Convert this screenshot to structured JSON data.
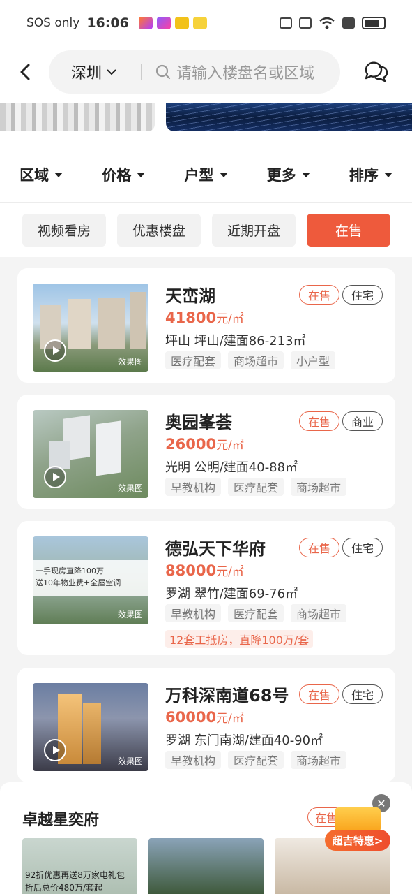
{
  "status_bar": {
    "carrier": "SOS only",
    "time": "16:06"
  },
  "header": {
    "city": "深圳",
    "search_placeholder": "请输入楼盘名或区域"
  },
  "filters": [
    "区域",
    "价格",
    "户型",
    "更多",
    "排序"
  ],
  "chips": [
    {
      "label": "视频看房",
      "active": false
    },
    {
      "label": "优惠楼盘",
      "active": false
    },
    {
      "label": "近期开盘",
      "active": false
    },
    {
      "label": "在售",
      "active": true
    }
  ],
  "listings": [
    {
      "name": "天峦湖",
      "status": "在售",
      "type": "住宅",
      "price": "41800",
      "price_unit": "元/㎡",
      "location": "坪山 坪山/建面86-213㎡",
      "tags": [
        "医疗配套",
        "商场超市",
        "小户型"
      ],
      "image_label": "效果图"
    },
    {
      "name": "奥园峯荟",
      "status": "在售",
      "type": "商业",
      "price": "26000",
      "price_unit": "元/㎡",
      "location": "光明 公明/建面40-88㎡",
      "tags": [
        "早教机构",
        "医疗配套",
        "商场超市"
      ],
      "image_label": "效果图"
    },
    {
      "name": "德弘天下华府",
      "status": "在售",
      "type": "住宅",
      "price": "88000",
      "price_unit": "元/㎡",
      "location": "罗湖 翠竹/建面69-76㎡",
      "tags": [
        "早教机构",
        "医疗配套",
        "商场超市"
      ],
      "promo": "12套工抵房，直降100万/套",
      "image_promo_line1": "一手现房直降100万",
      "image_promo_line2": "送10年物业费+全屋空调",
      "image_label": "效果图"
    },
    {
      "name": "万科深南道68号",
      "status": "在售",
      "type": "住宅",
      "price": "60000",
      "price_unit": "元/㎡",
      "location": "罗湖 东门南湖/建面40-90㎡",
      "tags": [
        "早教机构",
        "医疗配套",
        "商场超市"
      ],
      "image_label": "效果图"
    }
  ],
  "bottom": {
    "title": "卓越星奕府",
    "badge": "在售",
    "thumb_text_line1": "92折优惠再送8万家电礼包",
    "thumb_text_line2": "折后总价480万/套起"
  },
  "float_promo": {
    "label": "超吉特惠>"
  },
  "colors": {
    "accent": "#ee5a3c",
    "price": "#e9664a"
  }
}
